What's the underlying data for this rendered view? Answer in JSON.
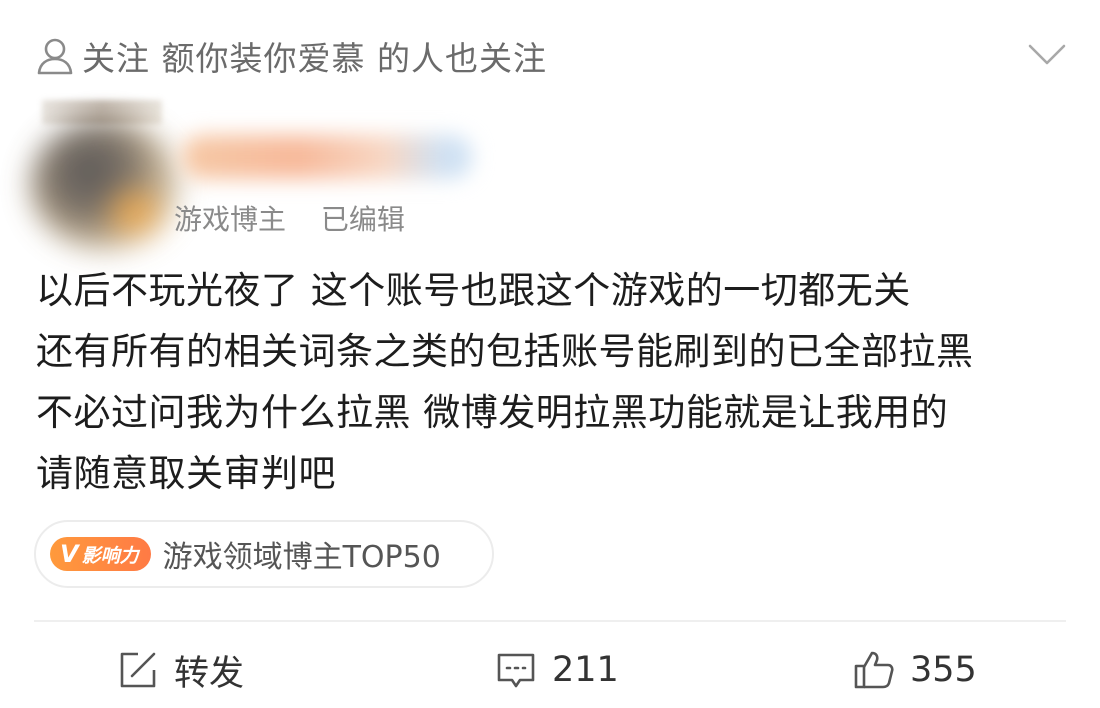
{
  "follow_bar": {
    "text": "关注 额你装你爱慕 的人也关注"
  },
  "author": {
    "role": "游戏博主",
    "edited": "已编辑"
  },
  "post": {
    "lines": [
      "以后不玩光夜了 这个账号也跟这个游戏的一切都无关",
      "还有所有的相关词条之类的包括账号能刷到的已全部拉黑",
      "不必过问我为什么拉黑 微博发明拉黑功能就是让我用的",
      "请随意取关审判吧"
    ]
  },
  "influence_tag": {
    "badge_v": "V",
    "badge_label": "影响力",
    "text": "游戏领域博主TOP50"
  },
  "actions": {
    "repost_label": "转发",
    "comment_count": "211",
    "like_count": "355"
  },
  "icons": {
    "follow": "user-icon",
    "expand": "chevron-down-icon",
    "repost": "edit-share-icon",
    "comment": "comment-icon",
    "like": "thumbs-up-icon"
  },
  "colors": {
    "badge_orange": "#ff8a3d",
    "secondary_text": "#8a8a8a"
  }
}
